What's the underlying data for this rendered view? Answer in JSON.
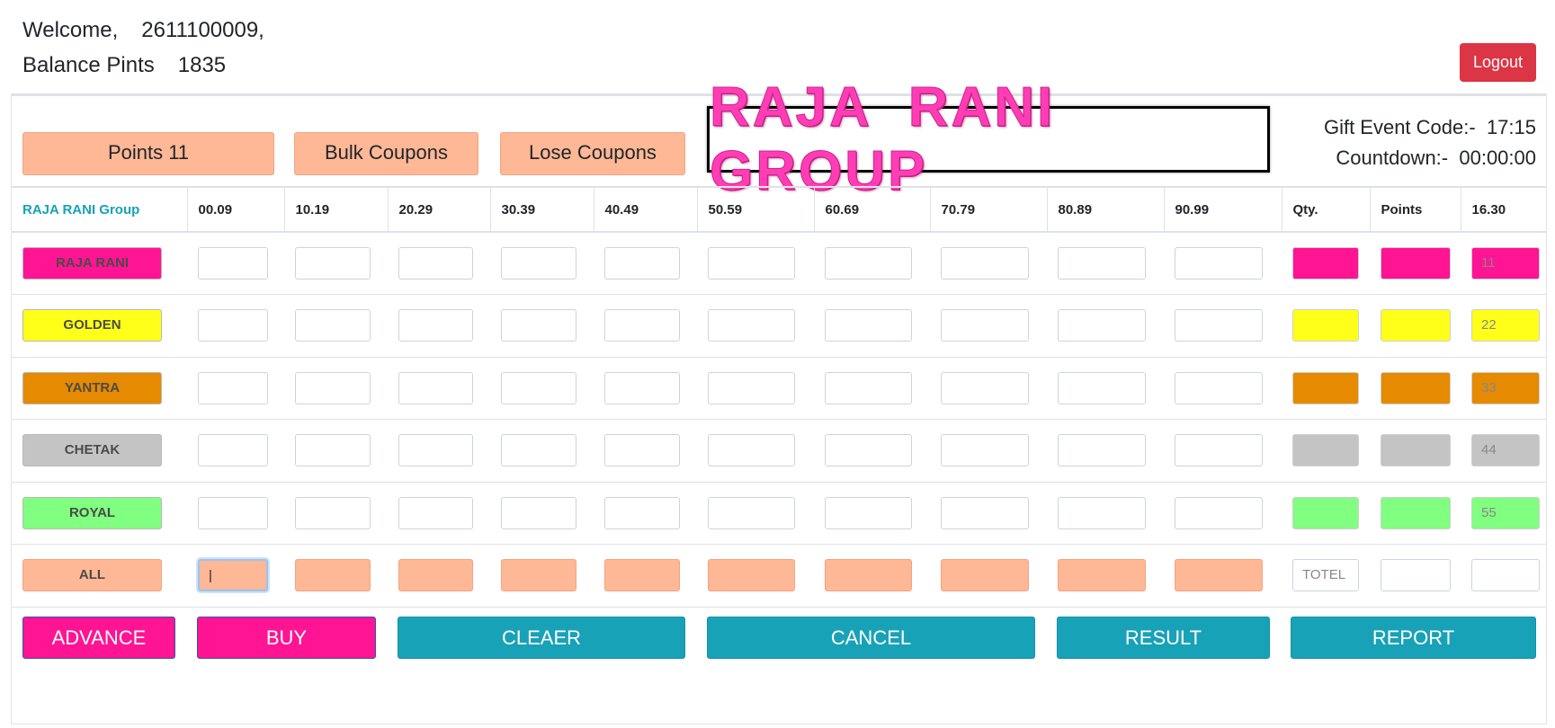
{
  "header": {
    "welcome_label": "Welcome,",
    "user_id": "2611100009,",
    "balance_label": "Balance Pints",
    "balance_value": "1835",
    "logout_label": "Logout"
  },
  "top_buttons": {
    "points": "Points 11",
    "bulk": "Bulk Coupons",
    "lose": "Lose Coupons"
  },
  "logo_text": "RAJA RANI GROUP",
  "gift": {
    "event_label": "Gift Event Code:-",
    "event_value": "17:15",
    "countdown_label": "Countdown:-",
    "countdown_value": "00:00:00"
  },
  "table": {
    "headers": [
      "RAJA RANI Group",
      "00.09",
      "10.19",
      "20.29",
      "30.39",
      "40.49",
      "50.59",
      "60.69",
      "70.79",
      "80.89",
      "90.99",
      "Qty.",
      "Points",
      "16.30"
    ],
    "rows": [
      {
        "label": "RAJA RANI",
        "color": "#ff1493",
        "last_value": "11"
      },
      {
        "label": "GOLDEN",
        "color": "#ffff1a",
        "last_value": "22"
      },
      {
        "label": "YANTRA",
        "color": "#e68a00",
        "last_value": "33"
      },
      {
        "label": "CHETAK",
        "color": "#c4c4c4",
        "last_value": "44"
      },
      {
        "label": "ROYAL",
        "color": "#80ff80",
        "last_value": "55"
      }
    ],
    "all_row": {
      "label": "ALL",
      "qty_placeholder": "TOTEL",
      "input_value": "|"
    }
  },
  "actions": {
    "advance": "ADVANCE",
    "buy": "BUY",
    "clear": "CLEAER",
    "cancel": "CANCEL",
    "result": "RESULT",
    "report": "REPORT"
  },
  "colors": {
    "peach": "#ffb896",
    "teal": "#17a2b8",
    "pink": "#ff1493",
    "danger": "#dc3545"
  }
}
